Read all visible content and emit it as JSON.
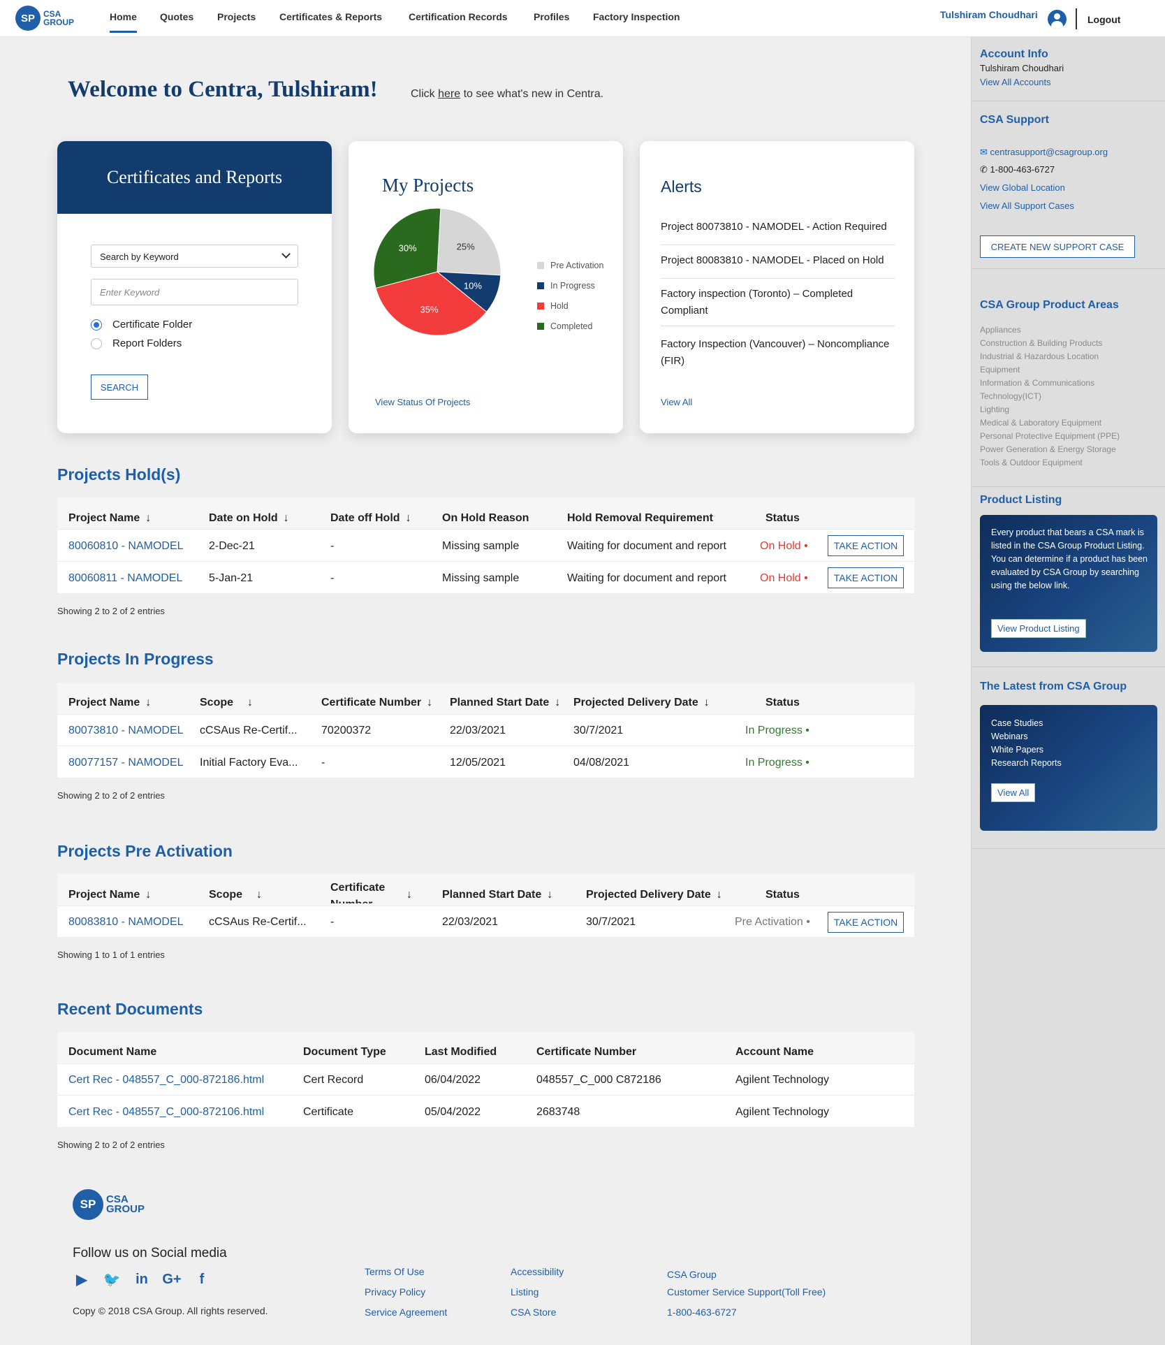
{
  "nav": {
    "logo_mark": "SP",
    "logo_text_1": "CSA",
    "logo_text_2": "GROUP",
    "items": [
      "Home",
      "Quotes",
      "Projects",
      "Certificates & Reports",
      "Certification Records",
      "Profiles",
      "Factory Inspection"
    ],
    "active": "Home",
    "user_name": "Tulshiram Choudhari",
    "logout": "Logout"
  },
  "welcome": {
    "title": "Welcome to Centra, Tulshiram!",
    "note_prefix": "Click ",
    "note_link": "here",
    "note_suffix": " to see what's new in Centra."
  },
  "cert_card": {
    "title": "Certificates and Reports",
    "select_value": "Search by Keyword",
    "keyword_placeholder": "Enter Keyword",
    "radio_1": "Certificate Folder",
    "radio_2": "Report Folders",
    "radio_selected": "Certificate Folder",
    "search_button": "SEARCH"
  },
  "projects_card": {
    "title": "My Projects",
    "link": "View Status Of Projects"
  },
  "chart_data": {
    "type": "pie",
    "title": "My Projects",
    "slices": [
      {
        "label": "Pre Activation",
        "value": 25,
        "color": "#d6d6d6"
      },
      {
        "label": "In Progress",
        "value": 10,
        "color": "#123c6d"
      },
      {
        "label": "Hold",
        "value": 35,
        "color": "#f23c3c"
      },
      {
        "label": "Completed",
        "value": 30,
        "color": "#2a6a1e"
      }
    ],
    "slice_labels": [
      "25%",
      "10%",
      "35%",
      "30%"
    ],
    "legend_placement": "right"
  },
  "alerts_card": {
    "title": "Alerts",
    "items": [
      "Project 80073810 - NAMODEL - Action Required",
      "Project 80083810 - NAMODEL - Placed on Hold",
      "Factory inspection (Toronto) – Completed Compliant",
      "Factory Inspection (Vancouver) – Noncompliance (FIR)"
    ],
    "link": "View All"
  },
  "hold": {
    "title": "Projects Hold(s)",
    "headers": [
      "Project Name",
      "Date on Hold",
      "Date off Hold",
      "On Hold Reason",
      "Hold Removal Requirement",
      "Status"
    ],
    "rows": [
      [
        "80060810 - NAMODEL",
        "2-Dec-21",
        "-",
        "Missing sample",
        "Waiting for document and report",
        "On Hold •"
      ],
      [
        "80060811 - NAMODEL",
        "5-Jan-21",
        "-",
        "Missing sample",
        "Waiting for document and report",
        "On Hold •"
      ]
    ],
    "action_label": "TAKE ACTION",
    "showing": "Showing 2 to 2 of 2 entries"
  },
  "progress": {
    "title": "Projects In Progress",
    "headers": [
      "Project Name",
      "Scope",
      "Certificate Number",
      "Planned Start Date",
      "Projected Delivery Date",
      "Status"
    ],
    "rows": [
      [
        "80073810 - NAMODEL",
        "cCSAus Re-Certif...",
        "70200372",
        "22/03/2021",
        "30/7/2021",
        "In Progress •"
      ],
      [
        "80077157 - NAMODEL",
        "Initial Factory Eva...",
        "-",
        "12/05/2021",
        "04/08/2021",
        "In Progress •"
      ]
    ],
    "showing": "Showing 2 to 2 of 2 entries"
  },
  "pre": {
    "title": "Projects Pre Activation",
    "headers": [
      "Project Name",
      "Scope",
      "Certificate Number",
      "Planned Start Date",
      "Projected Delivery Date",
      "Status"
    ],
    "rows": [
      [
        "80083810 - NAMODEL",
        "cCSAus Re-Certif...",
        "-",
        "22/03/2021",
        "30/7/2021",
        "Pre Activation •"
      ]
    ],
    "action_label": "TAKE ACTION",
    "showing": "Showing 1 to 1 of 1 entries"
  },
  "docs": {
    "title": "Recent Documents",
    "headers": [
      "Document Name",
      "Document Type",
      "Last Modified",
      "Certificate Number",
      "Account Name"
    ],
    "rows": [
      [
        "Cert Rec - 048557_C_000-872186.html",
        "Cert Record",
        "06/04/2022",
        "048557_C_000 C872186",
        "Agilent Technology"
      ],
      [
        "Cert Rec - 048557_C_000-872106.html",
        "Certificate",
        "05/04/2022",
        "2683748",
        "Agilent Technology"
      ]
    ],
    "showing": "Showing 2 to 2 of 2 entries"
  },
  "sidebar": {
    "account_title": "Account Info",
    "account_name": "Tulshiram Choudhari",
    "view_accounts": "View All Accounts",
    "support_title": "CSA Support",
    "email": "centrasupport@csagroup.org",
    "phone": "1-800-463-6727",
    "global_location": "View Global Location",
    "support_cases": "View All Support Cases",
    "create_case": "CREATE NEW SUPPORT CASE",
    "areas_title": "CSA Group Product Areas",
    "areas": [
      "Appliances",
      "Construction & Building Products",
      "Industrial & Hazardous Location",
      "Equipment",
      "Information & Communications",
      "Technology(ICT)",
      "Lighting",
      "Medical & Laboratory Equipment",
      "Personal Protective Equipment (PPE)",
      "Power Generation & Energy Storage",
      "Tools & Outdoor Equipment"
    ],
    "listing_title": "Product Listing",
    "listing_text": "Every product that bears a CSA mark is listed in the CSA Group Product Listing. You can determine if a product has been evaluated by CSA Group by searching using the below link.",
    "listing_button": "View Product Listing",
    "latest_title": "The Latest from CSA Group",
    "latest_items": [
      "Case Studies",
      "Webinars",
      "White Papers",
      "Research Reports"
    ],
    "latest_button": "View All"
  },
  "footer": {
    "follow": "Follow us on Social media",
    "copyright": "Copy © 2018 CSA Group. All rights reserved.",
    "col1": [
      "Terms Of Use",
      "Privacy Policy",
      "Service Agreement"
    ],
    "col2": [
      "Accessibility",
      "Listing",
      "CSA Store"
    ],
    "col3": [
      "CSA Group",
      "Customer Service Support(Toll Free)",
      "1-800-463-6727"
    ],
    "social_icons": [
      "youtube-icon",
      "twitter-icon",
      "linkedin-icon",
      "google-plus-icon",
      "facebook-icon"
    ]
  }
}
